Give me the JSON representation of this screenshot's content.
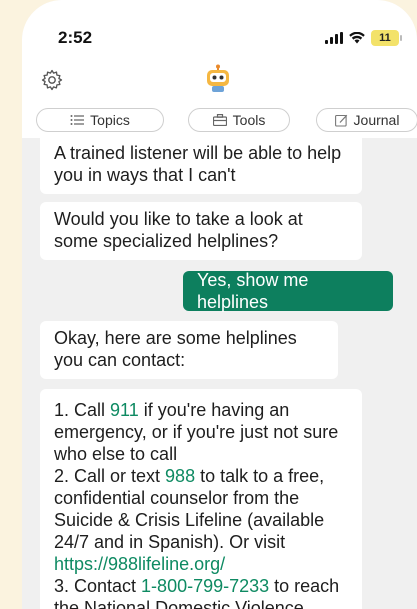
{
  "status": {
    "time": "2:52",
    "battery": "11"
  },
  "tabs": [
    {
      "label": "Topics",
      "icon": "list-icon"
    },
    {
      "label": "Tools",
      "icon": "toolbox-icon"
    },
    {
      "label": "Journal",
      "icon": "journal-icon"
    }
  ],
  "messages": [
    {
      "from": "bot",
      "text": "A trained listener will be able to help you in ways that I can't"
    },
    {
      "from": "bot",
      "text": "Would you like to take a look at some specialized helplines?"
    },
    {
      "from": "user",
      "text": "Yes, show me helplines"
    },
    {
      "from": "bot",
      "text": "Okay, here are some helplines you can contact:"
    }
  ],
  "helplines": {
    "item1_pre": "1. Call ",
    "item1_num": "911",
    "item1_post": " if you're having an emergency, or if you're just not sure who else to call",
    "item2_pre": "2. Call or text ",
    "item2_num": "988",
    "item2_post": " to talk to a free, confidential counselor from the Suicide & Crisis Lifeline (available 24/7 and in Spanish). Or visit ",
    "item2_link": "https://988lifeline.org/",
    "item3_pre": "3. Contact ",
    "item3_num": "1-800-799-7233",
    "item3_post": " to reach the National Domestic Violence"
  },
  "colors": {
    "background": "#FBF3DF",
    "user_bubble": "#0D7F5E",
    "link": "#0E8A62",
    "battery": "#F3E26A"
  }
}
